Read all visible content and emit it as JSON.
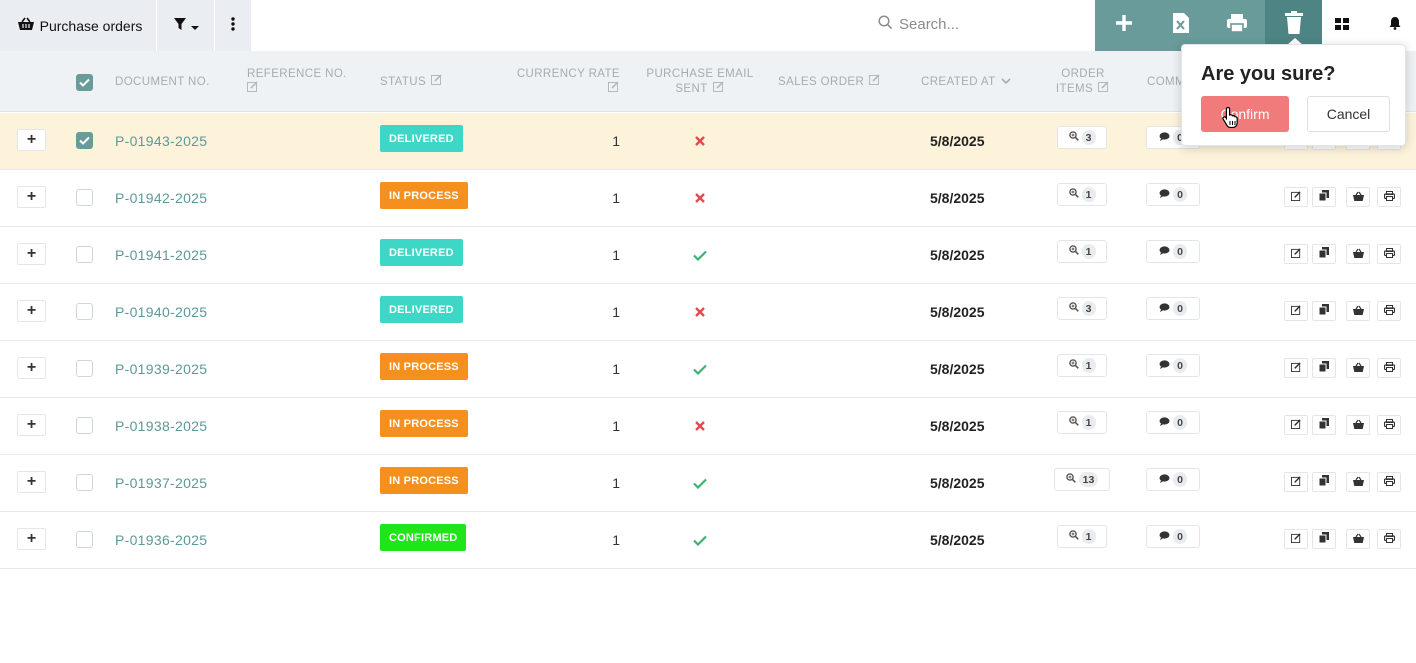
{
  "toolbar": {
    "title": "Purchase orders",
    "search_placeholder": "Search...",
    "action_icons": [
      "plus-icon",
      "excel-export-icon",
      "print-icon",
      "trash-icon"
    ],
    "extra_icons": [
      "grid-view-icon",
      "bell-icon"
    ]
  },
  "columns": {
    "document_no": "DOCUMENT NO.",
    "reference_no": "REFERENCE NO.",
    "status": "STATUS",
    "currency_rate": "CURRENCY RATE",
    "purchase_email_line1": "PURCHASE EMAIL",
    "purchase_email_line2": "SENT",
    "sales_order": "SALES ORDER",
    "created_at": "CREATED AT",
    "order_items_line1": "ORDER",
    "order_items_line2": "ITEMS",
    "comments": "COMM"
  },
  "status_colors": {
    "DELIVERED": "#3ed6c6",
    "IN PROCESS": "#f5901e",
    "CONFIRMED": "#22e41a"
  },
  "rows": [
    {
      "doc": "P-01943-2025",
      "status": "DELIVERED",
      "rate": "1",
      "email_sent": false,
      "created": "5/8/2025",
      "items": "3",
      "comments": "0",
      "selected": true
    },
    {
      "doc": "P-01942-2025",
      "status": "IN PROCESS",
      "rate": "1",
      "email_sent": false,
      "created": "5/8/2025",
      "items": "1",
      "comments": "0",
      "selected": false
    },
    {
      "doc": "P-01941-2025",
      "status": "DELIVERED",
      "rate": "1",
      "email_sent": true,
      "created": "5/8/2025",
      "items": "1",
      "comments": "0",
      "selected": false
    },
    {
      "doc": "P-01940-2025",
      "status": "DELIVERED",
      "rate": "1",
      "email_sent": false,
      "created": "5/8/2025",
      "items": "3",
      "comments": "0",
      "selected": false
    },
    {
      "doc": "P-01939-2025",
      "status": "IN PROCESS",
      "rate": "1",
      "email_sent": true,
      "created": "5/8/2025",
      "items": "1",
      "comments": "0",
      "selected": false
    },
    {
      "doc": "P-01938-2025",
      "status": "IN PROCESS",
      "rate": "1",
      "email_sent": false,
      "created": "5/8/2025",
      "items": "1",
      "comments": "0",
      "selected": false
    },
    {
      "doc": "P-01937-2025",
      "status": "IN PROCESS",
      "rate": "1",
      "email_sent": true,
      "created": "5/8/2025",
      "items": "13",
      "comments": "0",
      "selected": false
    },
    {
      "doc": "P-01936-2025",
      "status": "CONFIRMED",
      "rate": "1",
      "email_sent": true,
      "created": "5/8/2025",
      "items": "1",
      "comments": "0",
      "selected": false
    }
  ],
  "confirm_dialog": {
    "title": "Are you sure?",
    "confirm_label": "Confirm",
    "cancel_label": "Cancel"
  },
  "accent_color": "#699b9b"
}
